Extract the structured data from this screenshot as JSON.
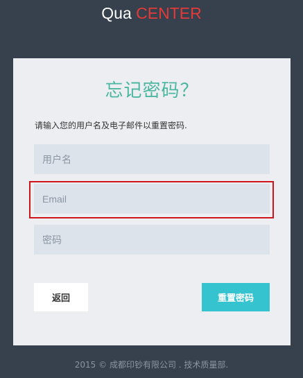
{
  "header": {
    "logo_part1": "Qua",
    "logo_part2": "CENTER"
  },
  "form": {
    "title": "忘记密码？",
    "instruction": "请输入您的用户名及电子邮件以重置密码.",
    "username": {
      "placeholder": "用户名",
      "value": ""
    },
    "email": {
      "placeholder": "Email",
      "value": ""
    },
    "password": {
      "placeholder": "密码",
      "value": ""
    },
    "back_label": "返回",
    "reset_label": "重置密码"
  },
  "footer": {
    "text": "2015 © 成都印钞有限公司 . 技术质量部."
  },
  "colors": {
    "background": "#36414d",
    "card": "#eceef2",
    "title": "#4cb7a0",
    "logo_accent": "#e33a3a",
    "reset_button": "#35c3cf",
    "highlight_border": "#d0121b"
  }
}
